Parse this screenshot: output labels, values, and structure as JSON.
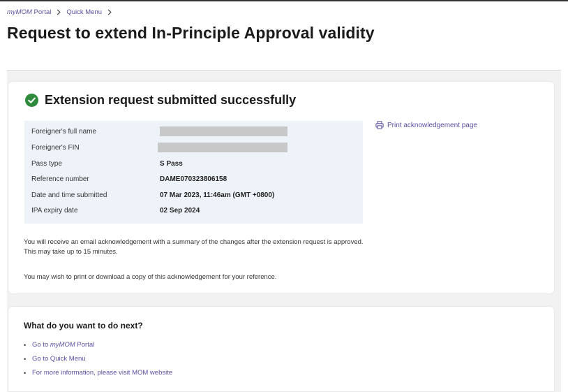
{
  "breadcrumb": {
    "items": [
      {
        "label_italic": "myMOM",
        "label_rest": " Portal"
      },
      {
        "label_italic": "",
        "label_rest": "Quick Menu"
      }
    ]
  },
  "page": {
    "title": "Request to extend In-Principle Approval validity"
  },
  "success": {
    "title": "Extension request submitted successfully",
    "color": "#2e8b3e"
  },
  "details": {
    "rows": [
      {
        "label": "Foreigner's full name",
        "value": ""
      },
      {
        "label": "Foreigner's FIN",
        "value": ""
      },
      {
        "label": "Pass type",
        "value": "S Pass"
      },
      {
        "label": "Reference number",
        "value": "DAME070323806158"
      },
      {
        "label": "Date and time submitted",
        "value": "07 Mar 2023, 11:46am (GMT +0800)"
      },
      {
        "label": "IPA expiry date",
        "value": "02 Sep 2024"
      }
    ]
  },
  "print_link": {
    "label": "Print acknowledgement page",
    "icon": "printer-icon"
  },
  "info": {
    "line1": "You will receive an email acknowledgement with a summary of the changes after the extension request is approved. This may take up to 15 minutes.",
    "line2": "You may wish to print or download a copy of this acknowledgement for your reference."
  },
  "next": {
    "title": "What do you want to do next?",
    "links": [
      {
        "pre": "Go to ",
        "italic": "myMOM",
        "post": " Portal"
      },
      {
        "pre": "Go to Quick Menu",
        "italic": "",
        "post": ""
      },
      {
        "pre": "For more information, please visit MOM website",
        "italic": "",
        "post": ""
      }
    ]
  },
  "colors": {
    "link": "#5a4fa0",
    "panel": "#eef3f9",
    "background": "#f2f2f3"
  }
}
